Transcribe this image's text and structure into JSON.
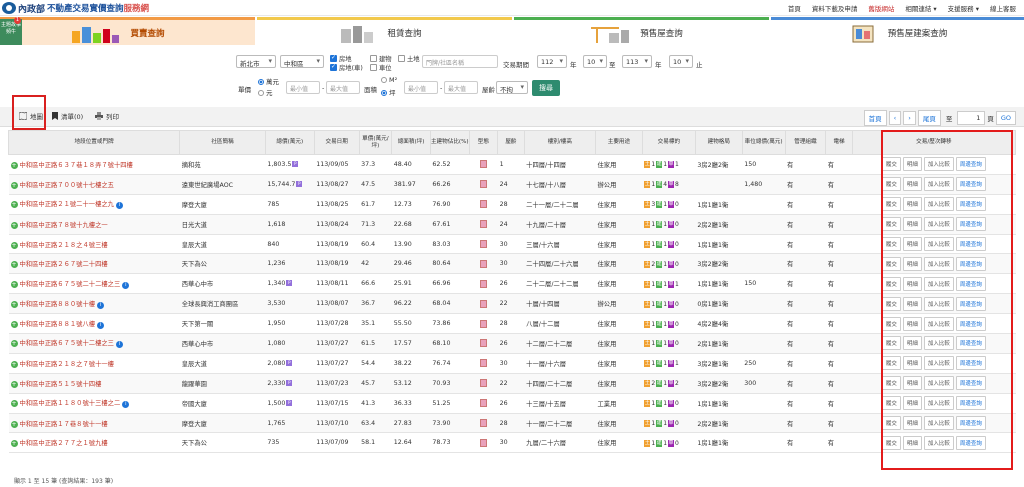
{
  "header": {
    "ministry": "內政部",
    "title": "不動產交易實價查詢",
    "title_suffix": "服務網",
    "nav": [
      "首頁",
      "資料下載及申請",
      "舊版網站",
      "相關連結 ▾",
      "支援服務 ▾",
      "線上客服"
    ]
  },
  "news_badge": {
    "label": "主題故事頻牛",
    "count": "1"
  },
  "categories": [
    "買賣查詢",
    "租賃查詢",
    "預售屋查詢",
    "預售屋建案查詢"
  ],
  "filters": {
    "city": "新北市",
    "district": "中和區",
    "types": [
      "房地",
      "房地(車)",
      "建物",
      "車位",
      "土地"
    ],
    "address_placeholder": "門牌/社區名稱",
    "period_label": "交易期間",
    "start_year": "112",
    "start_month": "10",
    "to_label": "至",
    "end_year": "113",
    "end_month": "10",
    "year_label": "年",
    "month_label": "月",
    "end_label": "止",
    "price_label": "單價",
    "price_units": [
      "萬元",
      "元"
    ],
    "min_placeholder": "最小值",
    "max_placeholder": "最大值",
    "area_label": "面積",
    "area_units": [
      "M²",
      "坪"
    ],
    "age_label": "屋齡",
    "age_value": "不拘",
    "search_label": "搜尋"
  },
  "toolbar": {
    "map": "地圖",
    "list": "清單(0)",
    "print": "列印",
    "pager": [
      "首頁",
      "‹",
      "›",
      "尾頁"
    ],
    "goto_label": "至",
    "page_value": "1",
    "page_unit": "頁",
    "go": "GO"
  },
  "table": {
    "headers": [
      "地段位置或門牌",
      "社區簡稱",
      "總價(萬元)",
      "交易日期",
      "單價(萬元/坪)",
      "總面積(坪)",
      "主建物佔比(%)",
      "型態",
      "屋齡",
      "樓別/樓高",
      "主要用途",
      "交易標的",
      "建物格局",
      "車位總價(萬元)",
      "管理組織",
      "電梯",
      "交易/歷次轉移"
    ],
    "actions": [
      "履交",
      "明細",
      "加入比較",
      "周邊查詢"
    ],
    "rows": [
      {
        "addr": "中和區中正路６３７巷１８弄７號十四樓",
        "name": "摘和苑",
        "price": "1,803.5",
        "p": true,
        "date": "113/09/05",
        "unit": "37.3",
        "area": "48.40",
        "ratio": "62.52",
        "age": "1",
        "floor": "十四層/十四層",
        "use": "住家用",
        "lay": [
          "1",
          "1",
          "1"
        ],
        "layout": "3房2廳2衛",
        "park": "150",
        "mgmt": "有",
        "elev": "有",
        "info": false
      },
      {
        "addr": "中和區中正路７００號十七樓之五",
        "name": "遠東世紀廣場AOC",
        "price": "15,744.7",
        "p": true,
        "date": "113/08/27",
        "unit": "47.5",
        "area": "381.97",
        "ratio": "66.26",
        "age": "24",
        "floor": "十七層/十八層",
        "use": "辦公用",
        "lay": [
          "1",
          "4",
          "8"
        ],
        "layout": "",
        "park": "1,480",
        "mgmt": "有",
        "elev": "有",
        "info": false
      },
      {
        "addr": "中和區中正路２１號二十一樓之九",
        "name": "摩登大廈",
        "price": "785",
        "p": false,
        "date": "113/08/25",
        "unit": "61.7",
        "area": "12.73",
        "ratio": "76.90",
        "age": "28",
        "floor": "二十一層/二十二層",
        "use": "住家用",
        "lay": [
          "3",
          "1",
          "0"
        ],
        "layout": "1房1廳1衛",
        "park": "",
        "mgmt": "有",
        "elev": "有",
        "info": true
      },
      {
        "addr": "中和區中正路７８號十九樓之一",
        "name": "日光大道",
        "price": "1,618",
        "p": false,
        "date": "113/08/24",
        "unit": "71.3",
        "area": "22.68",
        "ratio": "67.61",
        "age": "24",
        "floor": "十九層/二十層",
        "use": "住家用",
        "lay": [
          "1",
          "1",
          "0"
        ],
        "layout": "2房2廳1衛",
        "park": "",
        "mgmt": "有",
        "elev": "有",
        "info": false
      },
      {
        "addr": "中和區中正路２１８之４號三樓",
        "name": "皇辰大道",
        "price": "840",
        "p": false,
        "date": "113/08/19",
        "unit": "60.4",
        "area": "13.90",
        "ratio": "83.03",
        "age": "30",
        "floor": "三層/十六層",
        "use": "住家用",
        "lay": [
          "1",
          "1",
          "0"
        ],
        "layout": "1房1廳1衛",
        "park": "",
        "mgmt": "有",
        "elev": "有",
        "info": false
      },
      {
        "addr": "中和區中正路２６７號二十四樓",
        "name": "天下為公",
        "price": "1,236",
        "p": false,
        "date": "113/08/19",
        "unit": "42",
        "area": "29.46",
        "ratio": "80.64",
        "age": "30",
        "floor": "二十四層/二十六層",
        "use": "住家用",
        "lay": [
          "2",
          "1",
          "0"
        ],
        "layout": "3房2廳2衛",
        "park": "",
        "mgmt": "有",
        "elev": "有",
        "info": false
      },
      {
        "addr": "中和區中正路６７５號二十二樓之三",
        "name": "西華心中市",
        "price": "1,340",
        "p": true,
        "date": "113/08/11",
        "unit": "66.6",
        "area": "25.91",
        "ratio": "66.96",
        "age": "26",
        "floor": "二十二層/二十二層",
        "use": "住家用",
        "lay": [
          "1",
          "1",
          "1"
        ],
        "layout": "1房1廳1衛",
        "park": "150",
        "mgmt": "有",
        "elev": "有",
        "info": true
      },
      {
        "addr": "中和區中正路８８０號十樓",
        "name": "全球長興消工商團區",
        "price": "3,530",
        "p": false,
        "date": "113/08/07",
        "unit": "36.7",
        "area": "96.22",
        "ratio": "68.04",
        "age": "22",
        "floor": "十層/十四層",
        "use": "辦公用",
        "lay": [
          "1",
          "1",
          "0"
        ],
        "layout": "0房1廳1衛",
        "park": "",
        "mgmt": "有",
        "elev": "有",
        "info": true
      },
      {
        "addr": "中和區中正路８８１號八樓",
        "name": "天下第一關",
        "price": "1,950",
        "p": false,
        "date": "113/07/28",
        "unit": "35.1",
        "area": "55.50",
        "ratio": "73.86",
        "age": "28",
        "floor": "八層/十二層",
        "use": "住家用",
        "lay": [
          "1",
          "1",
          "0"
        ],
        "layout": "4房2廳4衛",
        "park": "",
        "mgmt": "有",
        "elev": "有",
        "info": true
      },
      {
        "addr": "中和區中正路６７５號十二樓之三",
        "name": "西華心中市",
        "price": "1,080",
        "p": false,
        "date": "113/07/27",
        "unit": "61.5",
        "area": "17.57",
        "ratio": "68.10",
        "age": "26",
        "floor": "十二層/二十二層",
        "use": "住家用",
        "lay": [
          "1",
          "1",
          "0"
        ],
        "layout": "2房1廳1衛",
        "park": "",
        "mgmt": "有",
        "elev": "有",
        "info": true
      },
      {
        "addr": "中和區中正路２１８之７號十一樓",
        "name": "皇辰大道",
        "price": "2,080",
        "p": true,
        "date": "113/07/27",
        "unit": "54.4",
        "area": "38.22",
        "ratio": "76.74",
        "age": "30",
        "floor": "十一層/十六層",
        "use": "住家用",
        "lay": [
          "1",
          "1",
          "1"
        ],
        "layout": "3房2廳1衛",
        "park": "250",
        "mgmt": "有",
        "elev": "有",
        "info": false
      },
      {
        "addr": "中和區中正路５１５號十四樓",
        "name": "龍躍華園",
        "price": "2,330",
        "p": true,
        "date": "113/07/23",
        "unit": "45.7",
        "area": "53.12",
        "ratio": "70.93",
        "age": "22",
        "floor": "十四層/二十二層",
        "use": "住家用",
        "lay": [
          "2",
          "1",
          "2"
        ],
        "layout": "3房2廳2衛",
        "park": "300",
        "mgmt": "有",
        "elev": "有",
        "info": false
      },
      {
        "addr": "中和區中正路１１８０號十三樓之二",
        "name": "帝國大廈",
        "price": "1,500",
        "p": true,
        "date": "113/07/15",
        "unit": "41.3",
        "area": "36.33",
        "ratio": "51.25",
        "age": "26",
        "floor": "十三層/十五層",
        "use": "工業用",
        "lay": [
          "1",
          "1",
          "0"
        ],
        "layout": "1房1廳1衛",
        "park": "",
        "mgmt": "有",
        "elev": "有",
        "info": true
      },
      {
        "addr": "中和區中正路１７巷８號十一樓",
        "name": "摩登大廈",
        "price": "1,765",
        "p": false,
        "date": "113/07/10",
        "unit": "63.4",
        "area": "27.83",
        "ratio": "73.90",
        "age": "28",
        "floor": "十一層/二十二層",
        "use": "住家用",
        "lay": [
          "1",
          "1",
          "0"
        ],
        "layout": "2房2廳1衛",
        "park": "",
        "mgmt": "有",
        "elev": "有",
        "info": false
      },
      {
        "addr": "中和區中正路２７７之１號九樓",
        "name": "天下為公",
        "price": "735",
        "p": false,
        "date": "113/07/09",
        "unit": "58.1",
        "area": "12.64",
        "ratio": "78.73",
        "age": "30",
        "floor": "九層/二十六層",
        "use": "住家用",
        "lay": [
          "1",
          "1",
          "0"
        ],
        "layout": "1房1廳1衛",
        "park": "",
        "mgmt": "有",
        "elev": "有",
        "info": false
      }
    ]
  },
  "footer": "顯示 1 至 15 筆 (查詢結果：193 筆)"
}
